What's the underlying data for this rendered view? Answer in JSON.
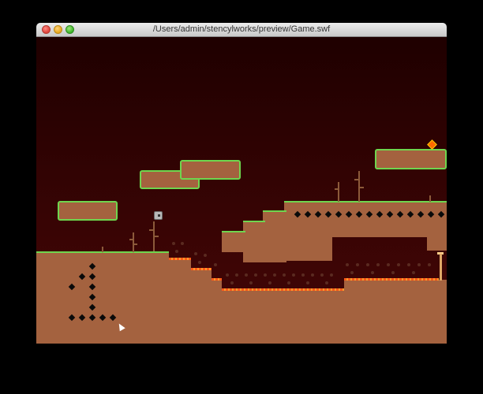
{
  "window": {
    "title": "/Users/admin/stencylworks/preview/Game.swf",
    "buttons": [
      "close",
      "minimize",
      "zoom"
    ]
  },
  "game": {
    "player": "player-block",
    "collectible": "gem-icon",
    "exit": "door",
    "colors": {
      "sky_top": "#1f0000",
      "sky_bottom": "#420607",
      "dirt": "#a4623f",
      "grass": "#6ed64e",
      "lava": "#ff5a1a"
    }
  }
}
